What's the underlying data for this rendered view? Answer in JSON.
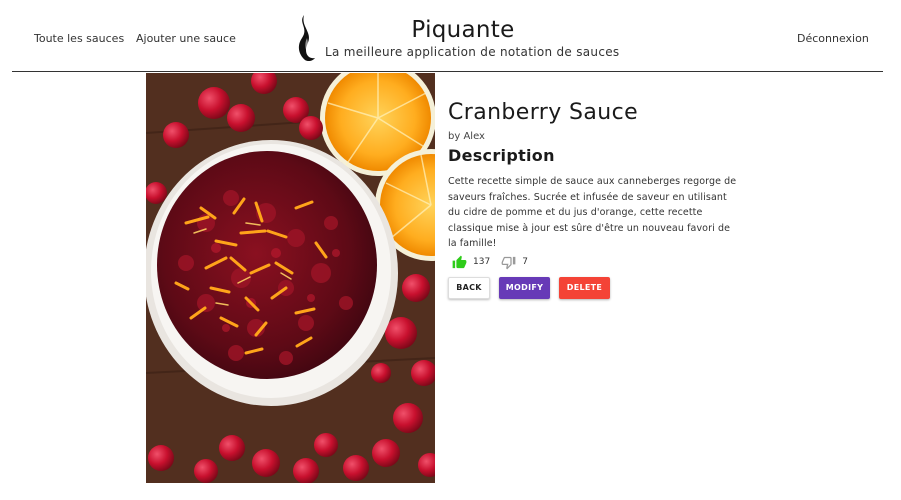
{
  "nav": {
    "all_sauces": "Toute les sauces",
    "add_sauce": "Ajouter une sauce",
    "logout": "Déconnexion"
  },
  "brand": {
    "title": "Piquante",
    "subtitle": "La meilleure application de notation de sauces",
    "logo_icon": "flame-icon"
  },
  "sauce": {
    "name": "Cranberry Sauce",
    "author": "by Alex",
    "description_heading": "Description",
    "description": "Cette recette simple de sauce aux canneberges regorge de saveurs fraîches. Sucrée et infusée de saveur en utilisant du cidre de pomme et du jus d'orange, cette recette classique mise à jour est sûre d'être un nouveau favori de la famille!",
    "likes": "137",
    "dislikes": "7",
    "like_icon": "thumbs-up-icon",
    "dislike_icon": "thumbs-down-icon"
  },
  "actions": {
    "back": "BACK",
    "modify": "MODIFY",
    "delete": "DELETE"
  },
  "colors": {
    "like": "#2ecc1a",
    "modify": "#673ab7",
    "delete": "#f44336"
  }
}
